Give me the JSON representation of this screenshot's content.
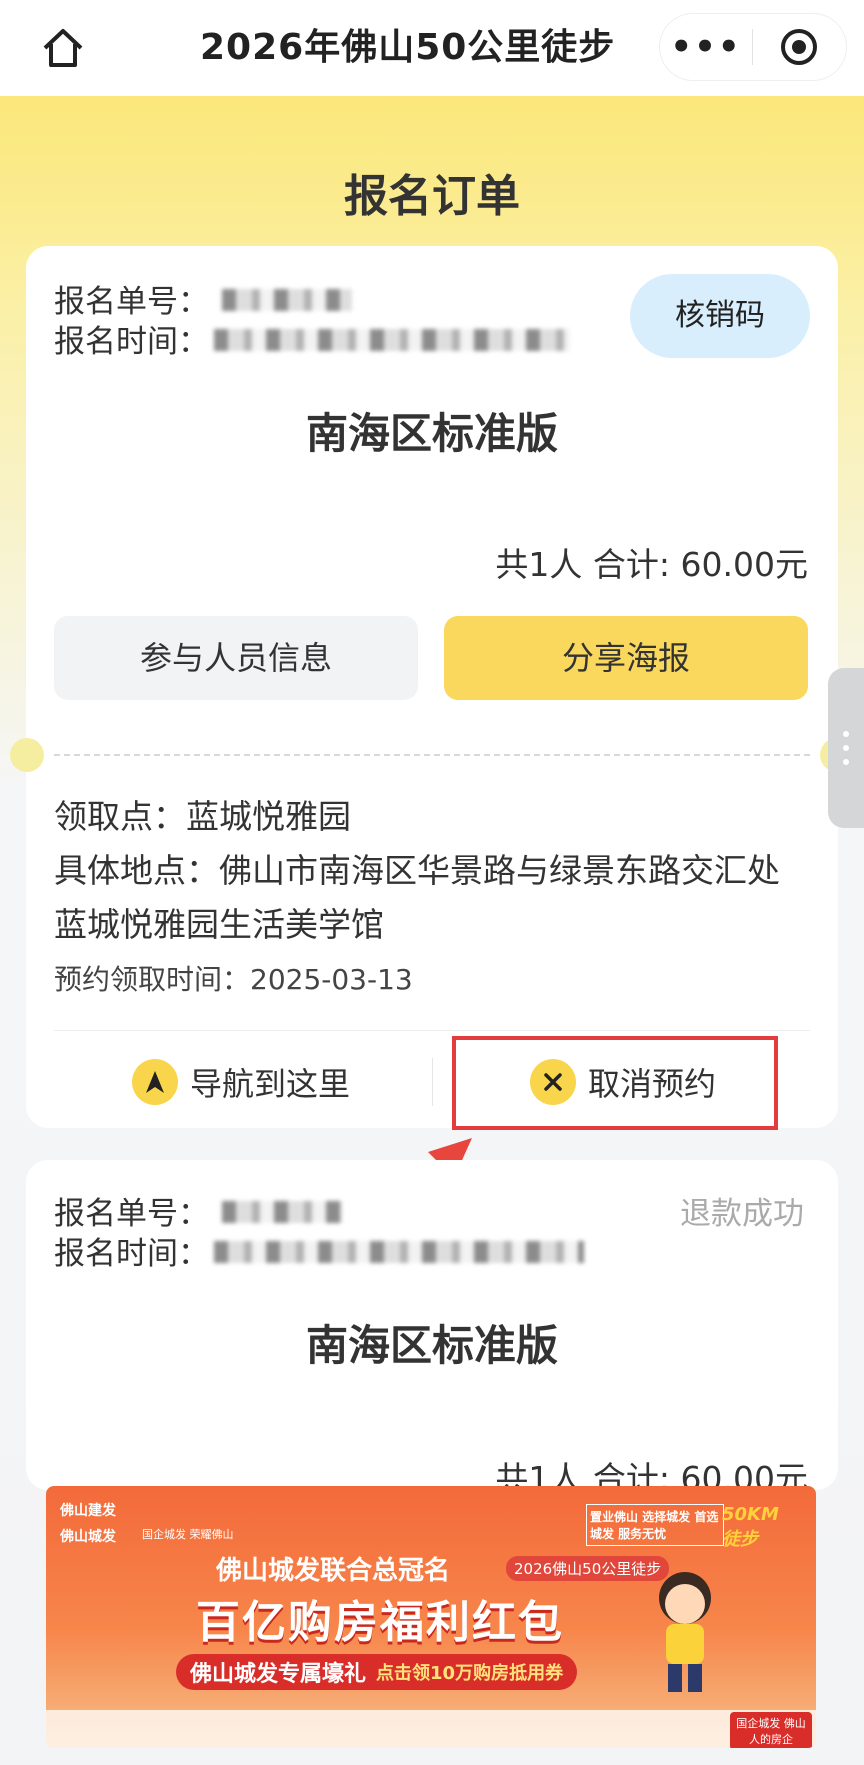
{
  "topbar": {
    "title": "2026年佛山50公里徒步",
    "more_icon": "more-dots-icon",
    "record_icon": "record-icon",
    "home_icon": "home-icon"
  },
  "page": {
    "title": "报名订单"
  },
  "order1": {
    "order_no_label": "报名单号：",
    "time_label": "报名时间：",
    "verify_button": "核销码",
    "plan": "南海区标准版",
    "total": "共1人 合计: 60.00元",
    "participants_button": "参与人员信息",
    "share_button": "分享海报",
    "pickup_label": "领取点：蓝城悦雅园",
    "address": "具体地点：佛山市南海区华景路与绿景东路交汇处蓝城悦雅园生活美学馆",
    "appointment": "预约领取时间：2025-03-13",
    "navigate_button": "导航到这里",
    "cancel_button": "取消预约"
  },
  "order2": {
    "order_no_label": "报名单号：",
    "time_label": "报名时间：",
    "status": "退款成功",
    "plan": "南海区标准版",
    "total": "共1人 合计: 60.00元"
  },
  "banner": {
    "brand1": "佛山建发",
    "brand2": "佛山城发",
    "brand2_tag": "国企城发 荣耀佛山",
    "slogan_right": "置业佛山 选择城发 首选城发 服务无忧",
    "event_logo": "50KM 徒步",
    "sponsor": "佛山城发联合总冠名",
    "event_tag": "2026佛山50公里徒步",
    "headline": "百亿购房福利红包",
    "sub_left": "佛山城发专属壕礼",
    "sub_right": "点击领10万购房抵用券",
    "corner": "国企城发 佛山人的房企"
  },
  "colors": {
    "accent_yellow": "#fad75d",
    "verify_blue": "#d9eefc",
    "highlight_red": "#e23c3c"
  }
}
